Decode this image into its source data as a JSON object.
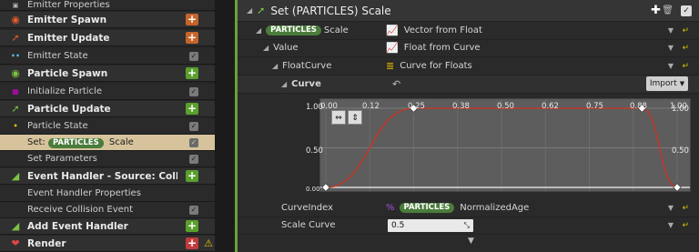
{
  "stack": {
    "items": [
      {
        "label": "Emitter Properties",
        "kind": "sub-top",
        "icon": "cpu-icon"
      },
      {
        "label": "Emitter Spawn",
        "kind": "header",
        "button": "+",
        "button_color": "#c6642a",
        "icon": "spawn-icon",
        "icon_color": "#e35b25"
      },
      {
        "label": "Emitter Update",
        "kind": "header",
        "button": "+",
        "button_color": "#c6642a",
        "icon": "update-arrow-icon",
        "icon_color": "#e35b25"
      },
      {
        "label": "Emitter State",
        "kind": "sub",
        "checked": true,
        "icon": "dots-icon"
      },
      {
        "label": "Particle Spawn",
        "kind": "header",
        "button": "+",
        "button_color": "#5aa02c",
        "icon": "spawn-icon",
        "icon_color": "#7dc142"
      },
      {
        "label": "Initialize Particle",
        "kind": "sub",
        "checked": true,
        "icon": "grid-icon"
      },
      {
        "label": "Particle Update",
        "kind": "header",
        "button": "+",
        "button_color": "#5aa02c",
        "icon": "update-arrow-icon",
        "icon_color": "#7dc142"
      },
      {
        "label": "Particle State",
        "kind": "sub",
        "checked": true,
        "icon": "dot-icon"
      },
      {
        "label_prefix": "Set:",
        "pill": "PARTICLES",
        "label_suffix": "Scale",
        "kind": "selected",
        "checked": true
      },
      {
        "label": "Set Parameters",
        "kind": "sub",
        "checked": true
      },
      {
        "label": "Event Handler - Source: CollisionEv",
        "kind": "header",
        "button": "+",
        "button_color": "#5aa02c",
        "icon": "signal-icon",
        "icon_color": "#7dc142"
      },
      {
        "label": "Event Handler Properties",
        "kind": "sub"
      },
      {
        "label": "Receive Collision Event",
        "kind": "sub",
        "checked": true
      },
      {
        "label": "Add Event Handler",
        "kind": "header",
        "button": "+",
        "button_color": "#5aa02c",
        "icon": "signal-icon",
        "icon_color": "#7dc142"
      },
      {
        "label": "Render",
        "kind": "header",
        "button": "+",
        "button_color": "#c23b3b",
        "icon": "heart-icon",
        "icon_color": "#e04545",
        "warning": true
      }
    ]
  },
  "details": {
    "title": "Set (PARTICLES) Scale",
    "title_prefix": "Set",
    "title_pill": "PARTICLES",
    "title_suffix": "Scale",
    "rows": {
      "scale": {
        "pill": "PARTICLES",
        "label": "Scale",
        "value": "Vector from Float"
      },
      "value": {
        "label": "Value",
        "value": "Float from Curve"
      },
      "floatcurve": {
        "label": "FloatCurve",
        "value": "Curve for Floats"
      },
      "curve": {
        "label": "Curve",
        "import_label": "Import"
      },
      "curveindex": {
        "label": "CurveIndex",
        "pill": "PARTICLES",
        "value": "NormalizedAge"
      },
      "scalecurve": {
        "label": "Scale Curve",
        "value": "0.5"
      }
    },
    "graph": {
      "x_ticks": [
        "0.00",
        "0.12",
        "0.25",
        "0.38",
        "0.50",
        "0.62",
        "0.75",
        "0.88",
        "1.00"
      ],
      "y_ticks": [
        "1.00",
        "0.50",
        "0.00"
      ],
      "right_y_ticks": [
        "1.00",
        "0.50"
      ],
      "points": [
        {
          "t": 0.0,
          "v": 0.0
        },
        {
          "t": 0.25,
          "v": 1.0
        },
        {
          "t": 0.9,
          "v": 1.0
        },
        {
          "t": 1.0,
          "v": 0.0
        }
      ]
    }
  }
}
